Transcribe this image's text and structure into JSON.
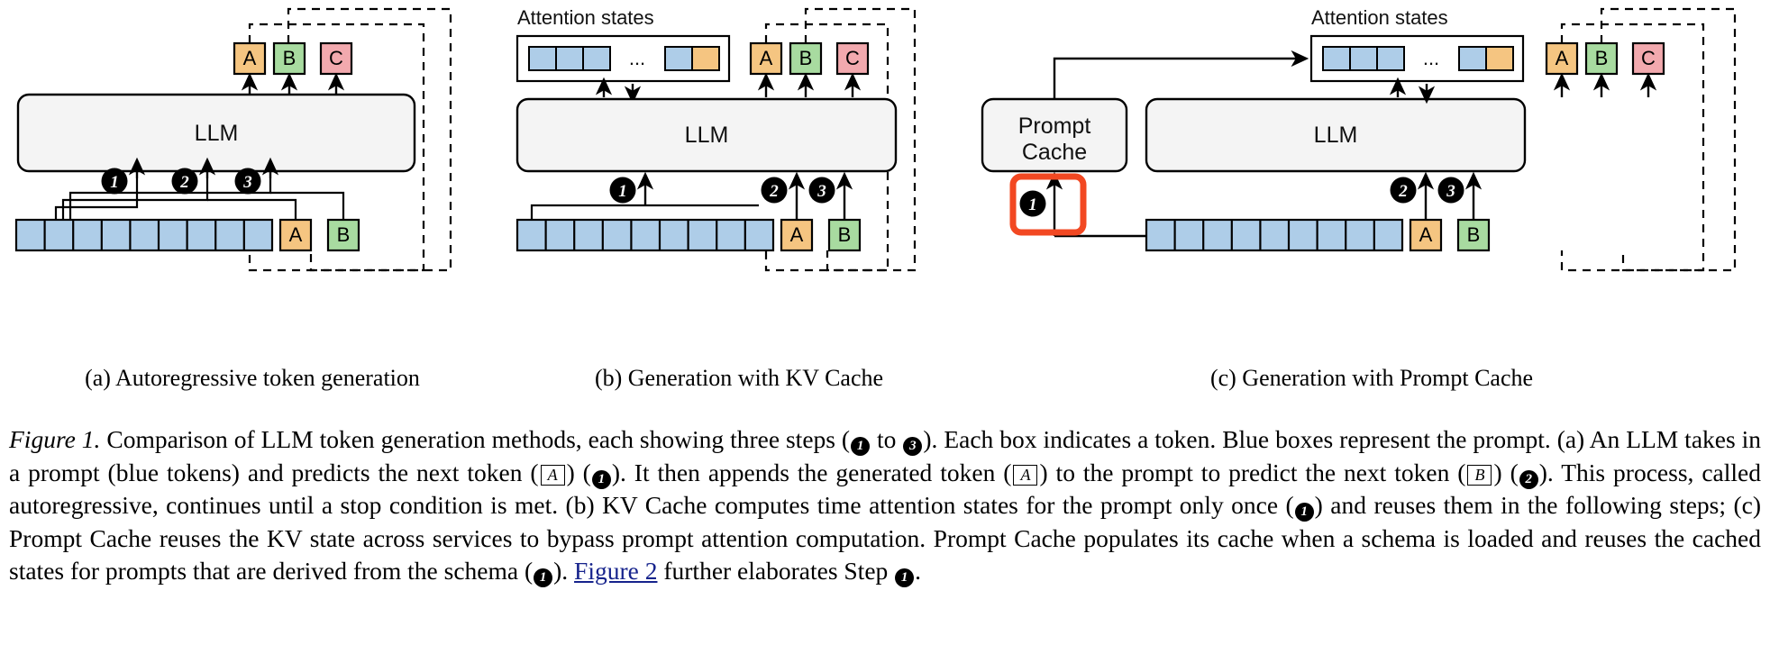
{
  "figure": {
    "panels": [
      {
        "id": "a",
        "subcaption": "(a) Autoregressive token generation",
        "llm_label": "LLM",
        "output_tokens": [
          "A",
          "B",
          "C"
        ],
        "appended_tokens": [
          "A",
          "B"
        ],
        "prompt_token_count": 9,
        "steps": [
          "1",
          "2",
          "3"
        ]
      },
      {
        "id": "b",
        "subcaption": "(b) Generation with KV Cache",
        "llm_label": "LLM",
        "attention_label": "Attention states",
        "attention_ellipsis": "...",
        "output_tokens": [
          "A",
          "B",
          "C"
        ],
        "appended_tokens": [
          "A",
          "B"
        ],
        "prompt_token_count": 9,
        "steps": [
          "1",
          "2",
          "3"
        ]
      },
      {
        "id": "c",
        "subcaption": "(c) Generation with Prompt Cache",
        "llm_label": "LLM",
        "cache_label_line1": "Prompt",
        "cache_label_line2": "Cache",
        "attention_label": "Attention states",
        "attention_ellipsis": "...",
        "output_tokens": [
          "A",
          "B",
          "C"
        ],
        "appended_tokens": [
          "A",
          "B"
        ],
        "prompt_token_count": 9,
        "steps": [
          "1",
          "2",
          "3"
        ]
      }
    ],
    "colors": {
      "prompt_blue": "#aecde8",
      "token_a_orange": "#f5c581",
      "token_b_green": "#a8dba0",
      "token_c_red": "#f2a9ae",
      "llm_fill": "#f4f4f4",
      "highlight_red": "#f24822",
      "stroke": "#000000",
      "link_blue": "#16238c"
    }
  },
  "caption": {
    "label": "Figure 1.",
    "seg1": " Comparison of LLM token generation methods, each showing three steps (",
    "step1": "1",
    "seg2": " to ",
    "step3": "3",
    "seg3": "). Each box indicates a token. Blue boxes represent the prompt. (a) An LLM takes in a prompt (blue tokens) and predicts the next token (",
    "boxA1": "A",
    "seg4": ") (",
    "step1b": "1",
    "seg5": "). It then appends the generated token (",
    "boxA2": "A",
    "seg6": ") to the prompt to predict the next token (",
    "boxB": "B",
    "seg7": ") (",
    "step2": "2",
    "seg8": "). This process, called autoregressive, continues until a stop condition is met. (b) KV Cache computes time attention states for the prompt only once (",
    "step1c": "1",
    "seg9": ") and reuses them in the following steps; (c) Prompt Cache reuses the KV state across services to bypass prompt attention computation. Prompt Cache populates its cache when a schema is loaded and reuses the cached states for prompts that are derived from the schema (",
    "step1d": "1",
    "seg10": "). ",
    "link_text": "Figure 2",
    "seg11": " further elaborates Step ",
    "step1e": "1",
    "seg12": "."
  }
}
